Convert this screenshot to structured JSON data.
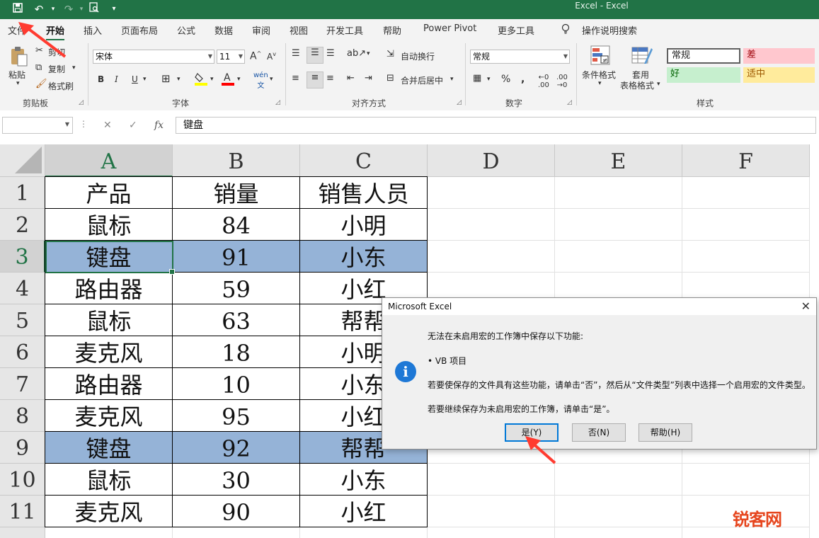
{
  "app": {
    "title": "Excel - Excel",
    "accent": "#217346"
  },
  "quick_access": {
    "save_icon": "save-icon",
    "undo_icon": "undo-icon",
    "redo_icon": "redo-icon",
    "preview_icon": "print-preview-icon",
    "customize_icon": "customize-icon"
  },
  "menu_tabs": [
    "文件",
    "开始",
    "插入",
    "页面布局",
    "公式",
    "数据",
    "审阅",
    "视图",
    "开发工具",
    "帮助",
    "Power Pivot",
    "更多工具"
  ],
  "active_tab": "开始",
  "tell_me": "操作说明搜索",
  "ribbon": {
    "clipboard": {
      "label": "剪贴板",
      "paste": "粘贴",
      "cut": "剪切",
      "copy": "复制",
      "format_painter": "格式刷"
    },
    "font": {
      "label": "字体",
      "font_name": "宋体",
      "font_size": "11",
      "bold": "B",
      "italic": "I",
      "underline": "U"
    },
    "alignment": {
      "label": "对齐方式",
      "wrap_text": "自动换行",
      "merge_center": "合并后居中"
    },
    "number": {
      "label": "数字",
      "format": "常规",
      "percent": "%"
    },
    "styles": {
      "label": "样式",
      "conditional": "条件格式",
      "format_table_1": "套用",
      "format_table_2": "表格格式",
      "cells": {
        "normal": "常规",
        "bad": "差",
        "good": "好",
        "neutral": "适中"
      }
    }
  },
  "formula_bar": {
    "name_box": "",
    "fx": "fx",
    "content": "键盘"
  },
  "columns": [
    "A",
    "B",
    "C",
    "D",
    "E",
    "F"
  ],
  "rows": [
    {
      "n": "1",
      "cells": [
        "产品",
        "销量",
        "销售人员"
      ]
    },
    {
      "n": "2",
      "cells": [
        "鼠标",
        "84",
        "小明"
      ]
    },
    {
      "n": "3",
      "cells": [
        "键盘",
        "91",
        "小东"
      ]
    },
    {
      "n": "4",
      "cells": [
        "路由器",
        "59",
        "小红"
      ]
    },
    {
      "n": "5",
      "cells": [
        "鼠标",
        "63",
        "帮帮"
      ]
    },
    {
      "n": "6",
      "cells": [
        "麦克风",
        "18",
        "小明"
      ]
    },
    {
      "n": "7",
      "cells": [
        "路由器",
        "10",
        "小东"
      ]
    },
    {
      "n": "8",
      "cells": [
        "麦克风",
        "95",
        "小红"
      ]
    },
    {
      "n": "9",
      "cells": [
        "键盘",
        "92",
        "帮帮"
      ]
    },
    {
      "n": "10",
      "cells": [
        "鼠标",
        "30",
        "小东"
      ]
    },
    {
      "n": "11",
      "cells": [
        "麦克风",
        "90",
        "小红"
      ]
    }
  ],
  "dialog": {
    "title": "Microsoft Excel",
    "line1": "无法在未启用宏的工作簿中保存以下功能:",
    "line2": "• VB 项目",
    "line3": "若要使保存的文件具有这些功能，请单击“否”，然后从“文件类型”列表中选择一个启用宏的文件类型。",
    "line4": "若要继续保存为未启用宏的工作簿，请单击“是”。",
    "yes": "是(Y)",
    "no": "否(N)",
    "help": "帮助(H)"
  },
  "watermark": "锐客网"
}
